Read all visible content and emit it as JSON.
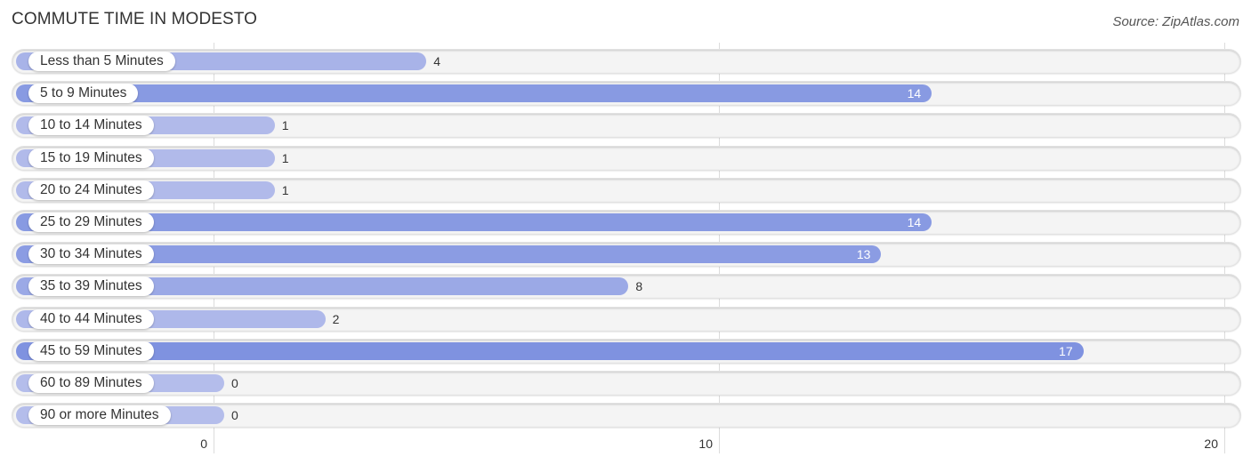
{
  "header": {
    "title": "COMMUTE TIME IN MODESTO",
    "source": "Source: ZipAtlas.com"
  },
  "chart_data": {
    "type": "bar",
    "orientation": "horizontal",
    "title": "COMMUTE TIME IN MODESTO",
    "source": "Source: ZipAtlas.com",
    "categories": [
      "Less than 5 Minutes",
      "5 to 9 Minutes",
      "10 to 14 Minutes",
      "15 to 19 Minutes",
      "20 to 24 Minutes",
      "25 to 29 Minutes",
      "30 to 34 Minutes",
      "35 to 39 Minutes",
      "40 to 44 Minutes",
      "45 to 59 Minutes",
      "60 to 89 Minutes",
      "90 or more Minutes"
    ],
    "values": [
      4,
      14,
      1,
      1,
      1,
      14,
      13,
      8,
      2,
      17,
      0,
      0
    ],
    "value_labels": [
      "4",
      "14",
      "1",
      "1",
      "1",
      "14",
      "13",
      "8",
      "2",
      "17",
      "0",
      "0"
    ],
    "xlim": [
      0,
      20
    ],
    "xticks": [
      0,
      10,
      20
    ],
    "xtick_labels": [
      "0",
      "10",
      "20"
    ],
    "xlabel": "",
    "ylabel": "",
    "grid": true,
    "legend": "none",
    "colors": {
      "bar_light": "#b4bdeb",
      "bar_dark": "#7f92e0",
      "track": "#f4f4f4",
      "value_inside": "#ffffff",
      "value_outside": "#333333"
    }
  }
}
